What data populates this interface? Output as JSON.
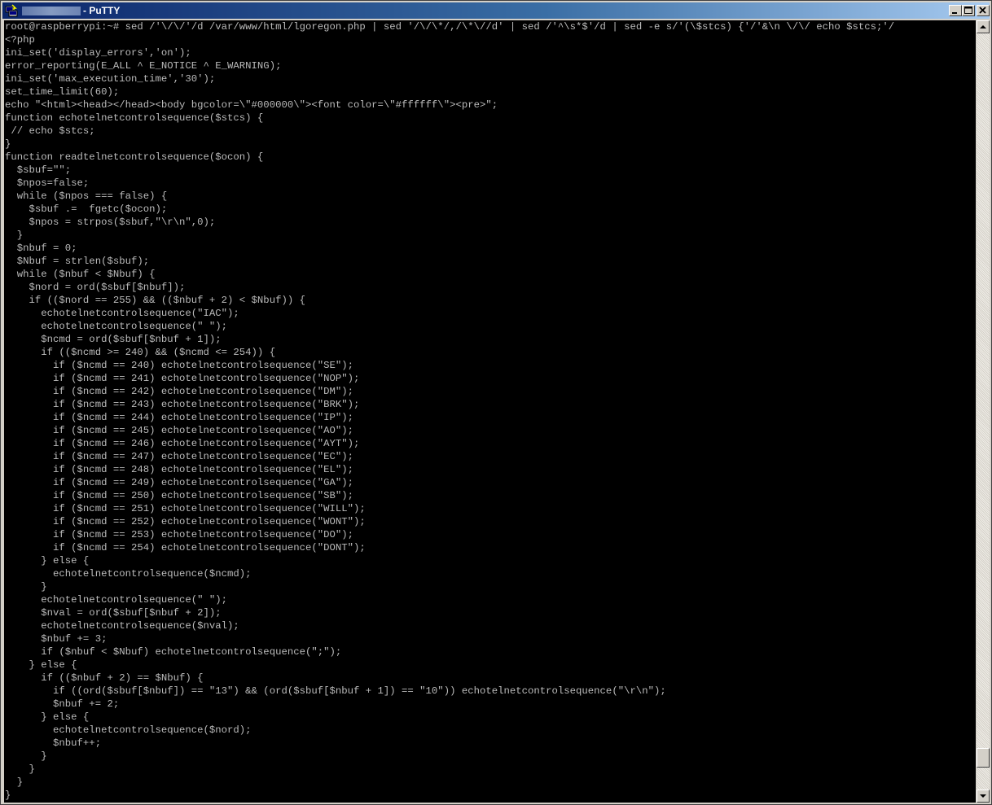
{
  "window": {
    "title": "- PuTTY",
    "icon": "putty-terminal-icon",
    "controls": [
      "minimize-icon",
      "maximize-icon",
      "close-icon"
    ]
  },
  "terminal": {
    "colors": {
      "background": "#000000",
      "foreground": "#bbbbbb"
    },
    "lines": [
      "root@raspberrypi:~# sed /'\\/\\/'/d /var/www/html/lgoregon.php | sed '/\\/\\*/,/\\*\\//d' | sed /'^\\s*$'/d | sed -e s/'(\\$stcs) {'/'&\\n \\/\\/ echo $stcs;'/",
      "<?php",
      "ini_set('display_errors','on');",
      "error_reporting(E_ALL ^ E_NOTICE ^ E_WARNING);",
      "ini_set('max_execution_time','30');",
      "set_time_limit(60);",
      "echo \"<html><head></head><body bgcolor=\\\"#000000\\\"><font color=\\\"#ffffff\\\"><pre>\";",
      "function echotelnetcontrolsequence($stcs) {",
      " // echo $stcs;",
      "}",
      "function readtelnetcontrolsequence($ocon) {",
      "  $sbuf=\"\";",
      "  $npos=false;",
      "  while ($npos === false) {",
      "    $sbuf .=  fgetc($ocon);",
      "    $npos = strpos($sbuf,\"\\r\\n\",0);",
      "  }",
      "  $nbuf = 0;",
      "  $Nbuf = strlen($sbuf);",
      "  while ($nbuf < $Nbuf) {",
      "    $nord = ord($sbuf[$nbuf]);",
      "    if (($nord == 255) && (($nbuf + 2) < $Nbuf)) {",
      "      echotelnetcontrolsequence(\"IAC\");",
      "      echotelnetcontrolsequence(\" \");",
      "      $ncmd = ord($sbuf[$nbuf + 1]);",
      "      if (($ncmd >= 240) && ($ncmd <= 254)) {",
      "        if ($ncmd == 240) echotelnetcontrolsequence(\"SE\");",
      "        if ($ncmd == 241) echotelnetcontrolsequence(\"NOP\");",
      "        if ($ncmd == 242) echotelnetcontrolsequence(\"DM\");",
      "        if ($ncmd == 243) echotelnetcontrolsequence(\"BRK\");",
      "        if ($ncmd == 244) echotelnetcontrolsequence(\"IP\");",
      "        if ($ncmd == 245) echotelnetcontrolsequence(\"AO\");",
      "        if ($ncmd == 246) echotelnetcontrolsequence(\"AYT\");",
      "        if ($ncmd == 247) echotelnetcontrolsequence(\"EC\");",
      "        if ($ncmd == 248) echotelnetcontrolsequence(\"EL\");",
      "        if ($ncmd == 249) echotelnetcontrolsequence(\"GA\");",
      "        if ($ncmd == 250) echotelnetcontrolsequence(\"SB\");",
      "        if ($ncmd == 251) echotelnetcontrolsequence(\"WILL\");",
      "        if ($ncmd == 252) echotelnetcontrolsequence(\"WONT\");",
      "        if ($ncmd == 253) echotelnetcontrolsequence(\"DO\");",
      "        if ($ncmd == 254) echotelnetcontrolsequence(\"DONT\");",
      "      } else {",
      "        echotelnetcontrolsequence($ncmd);",
      "      }",
      "      echotelnetcontrolsequence(\" \");",
      "      $nval = ord($sbuf[$nbuf + 2]);",
      "      echotelnetcontrolsequence($nval);",
      "      $nbuf += 3;",
      "      if ($nbuf < $Nbuf) echotelnetcontrolsequence(\";\");",
      "    } else {",
      "      if (($nbuf + 2) == $Nbuf) {",
      "        if ((ord($sbuf[$nbuf]) == \"13\") && (ord($sbuf[$nbuf + 1]) == \"10\")) echotelnetcontrolsequence(\"\\r\\n\");",
      "        $nbuf += 2;",
      "      } else {",
      "        echotelnetcontrolsequence($nord);",
      "        $nbuf++;",
      "      }",
      "    }",
      "  }",
      "}"
    ]
  },
  "scrollbar": {
    "up_icon": "arrow-up-icon",
    "down_icon": "arrow-down-icon",
    "position": 0.97
  }
}
